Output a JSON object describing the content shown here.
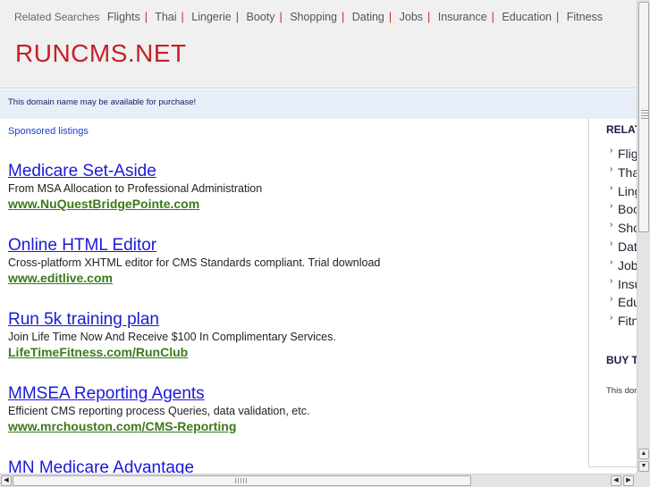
{
  "header": {
    "related_lead": "Related Searches",
    "related_links": [
      "Flights",
      "Thai",
      "Lingerie",
      "Booty",
      "Shopping",
      "Dating",
      "Jobs",
      "Insurance",
      "Education",
      "Fitness"
    ],
    "site_title": "RUNCMS.NET"
  },
  "notice": {
    "text": "This domain name may be available for purchase!"
  },
  "main": {
    "sponsored_label": "Sponsored listings",
    "listings": [
      {
        "title": "Medicare Set-Aside",
        "desc": "From MSA Allocation to Professional Administration",
        "url": "www.NuQuestBridgePointe.com"
      },
      {
        "title": "Online HTML Editor",
        "desc": "Cross-platform XHTML editor for CMS Standards compliant. Trial download",
        "url": "www.editlive.com"
      },
      {
        "title": "Run 5k training plan",
        "desc": "Join Life Time Now And Receive $100 In Complimentary Services.",
        "url": "LifeTimeFitness.com/RunClub"
      },
      {
        "title": "MMSEA Reporting Agents",
        "desc": "Efficient CMS reporting process Queries, data validation, etc.",
        "url": "www.mrchouston.com/CMS-Reporting"
      },
      {
        "title": "MN Medicare Advantage",
        "desc": "",
        "url": ""
      }
    ]
  },
  "sidebar": {
    "related_title": "RELAT",
    "items": [
      "Flig",
      "Tha",
      "Ling",
      "Boo",
      "Sho",
      "Dat",
      "Job",
      "Insu",
      "Edu",
      "Fitn"
    ],
    "buy_title": "BUY T",
    "buy_text": "This don"
  },
  "icons": {
    "scroll_up": "arrow-up-icon",
    "scroll_down": "arrow-down-icon",
    "scroll_left": "arrow-left-icon",
    "scroll_right": "arrow-right-icon"
  },
  "colors": {
    "title_red": "#c42127",
    "link_blue": "#1a1ad8",
    "url_green": "#3a7a18",
    "separator_red": "#cc2222"
  }
}
